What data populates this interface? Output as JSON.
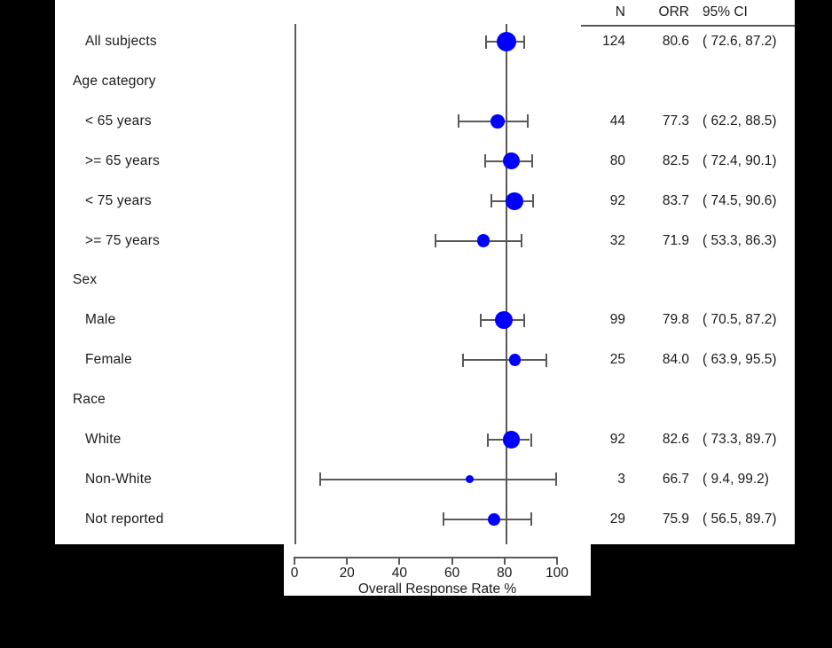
{
  "chart_data": {
    "type": "forest",
    "title": "",
    "xlabel": "Overall Response Rate %",
    "ylabel": "",
    "xlim": [
      0,
      100
    ],
    "xticks": [
      0,
      20,
      40,
      60,
      80,
      100
    ],
    "grid": false,
    "reference_line": 80.6,
    "marker_color": "#0000ff",
    "line_color": "#595959",
    "columns": [
      "N",
      "ORR",
      "95% CI"
    ],
    "rows": [
      {
        "label": "All subjects",
        "type": "row",
        "n": "124",
        "orr": "80.6",
        "ci": "( 72.6,  87.2)",
        "value": 80.6,
        "lower": 72.6,
        "upper": 87.2
      },
      {
        "label": "Age category",
        "type": "heading",
        "n": "",
        "orr": "",
        "ci": "",
        "value": null,
        "lower": null,
        "upper": null
      },
      {
        "label": "< 65 years",
        "type": "row",
        "n": "44",
        "orr": "77.3",
        "ci": "( 62.2,  88.5)",
        "value": 77.3,
        "lower": 62.2,
        "upper": 88.5
      },
      {
        "label": ">= 65 years",
        "type": "row",
        "n": "80",
        "orr": "82.5",
        "ci": "( 72.4,  90.1)",
        "value": 82.5,
        "lower": 72.4,
        "upper": 90.1
      },
      {
        "label": "< 75 years",
        "type": "row",
        "n": "92",
        "orr": "83.7",
        "ci": "( 74.5,  90.6)",
        "value": 83.7,
        "lower": 74.5,
        "upper": 90.6
      },
      {
        "label": ">= 75 years",
        "type": "row",
        "n": "32",
        "orr": "71.9",
        "ci": "( 53.3,  86.3)",
        "value": 71.9,
        "lower": 53.3,
        "upper": 86.3
      },
      {
        "label": "Sex",
        "type": "heading",
        "n": "",
        "orr": "",
        "ci": "",
        "value": null,
        "lower": null,
        "upper": null
      },
      {
        "label": "Male",
        "type": "row",
        "n": "99",
        "orr": "79.8",
        "ci": "( 70.5,  87.2)",
        "value": 79.8,
        "lower": 70.5,
        "upper": 87.2
      },
      {
        "label": "Female",
        "type": "row",
        "n": "25",
        "orr": "84.0",
        "ci": "( 63.9,  95.5)",
        "value": 84.0,
        "lower": 63.9,
        "upper": 95.5
      },
      {
        "label": "Race",
        "type": "heading",
        "n": "",
        "orr": "",
        "ci": "",
        "value": null,
        "lower": null,
        "upper": null
      },
      {
        "label": "White",
        "type": "row",
        "n": "92",
        "orr": "82.6",
        "ci": "( 73.3,  89.7)",
        "value": 82.6,
        "lower": 73.3,
        "upper": 89.7
      },
      {
        "label": "Non-White",
        "type": "row",
        "n": "3",
        "orr": "66.7",
        "ci": "(  9.4,  99.2)",
        "value": 66.7,
        "lower": 9.4,
        "upper": 99.2
      },
      {
        "label": "Not reported",
        "type": "row",
        "n": "29",
        "orr": "75.9",
        "ci": "( 56.5,  89.7)",
        "value": 75.9,
        "lower": 56.5,
        "upper": 89.7
      }
    ]
  },
  "table": {
    "header_n": "N",
    "header_orr": "ORR",
    "header_ci": "95% CI"
  },
  "axis": {
    "title": "Overall Response Rate %",
    "ticks": [
      "0",
      "20",
      "40",
      "60",
      "80",
      "100"
    ]
  }
}
